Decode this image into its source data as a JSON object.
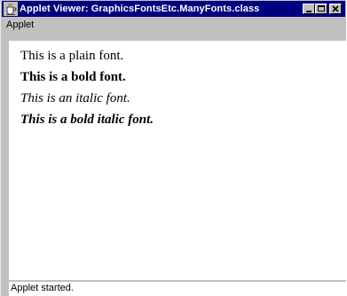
{
  "window": {
    "title": "Applet Viewer: GraphicsFontsEtc.ManyFonts.class",
    "icon": "java-coffee-cup-icon",
    "controls": [
      "minimize-icon",
      "maximize-icon",
      "close-icon"
    ]
  },
  "menubar": {
    "items": [
      {
        "label": "Applet"
      }
    ]
  },
  "content": {
    "lines": [
      {
        "text": "This is a plain font.",
        "style": "plain"
      },
      {
        "text": "This is a bold font.",
        "style": "bold"
      },
      {
        "text": "This is an italic font.",
        "style": "italic"
      },
      {
        "text": "This is a bold italic font.",
        "style": "bold-italic"
      }
    ]
  },
  "status": {
    "text": "Applet started."
  },
  "colors": {
    "titlebar": "#000080",
    "title_text": "#ffffff",
    "chrome": "#c0c0c0",
    "content_background": "#ffffff"
  }
}
